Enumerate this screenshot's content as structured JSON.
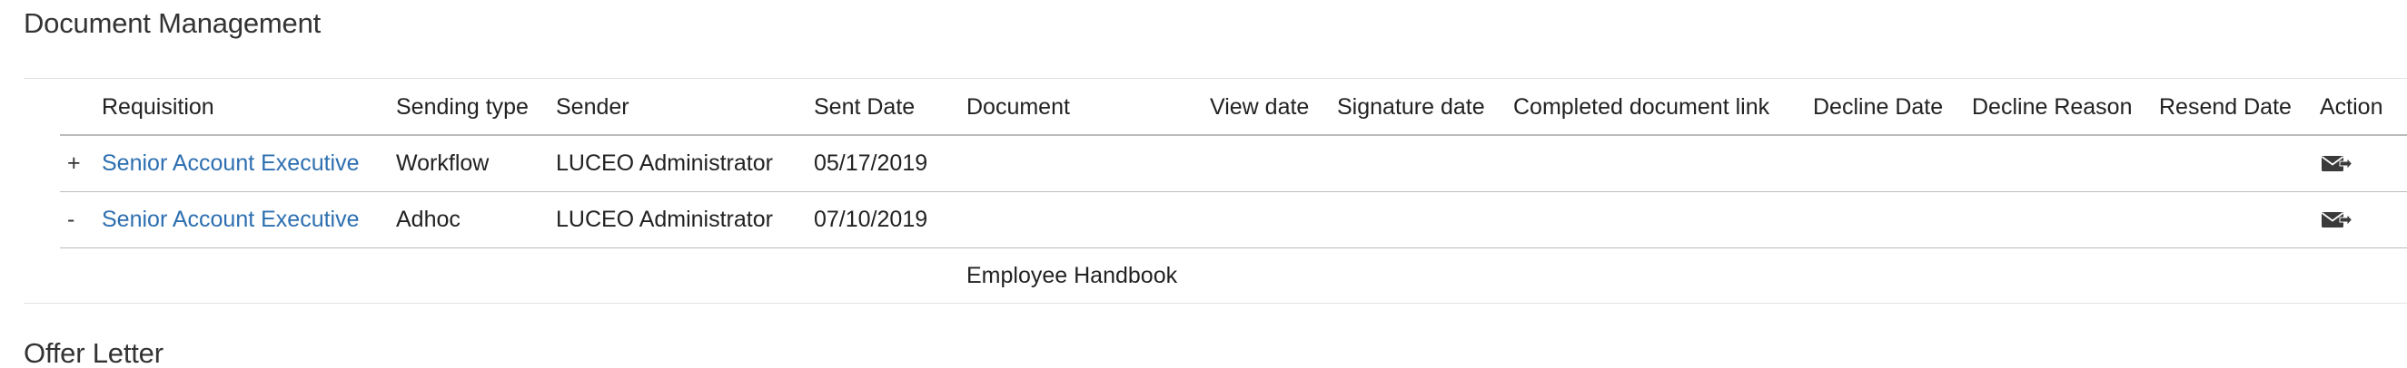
{
  "document_management": {
    "title": "Document Management",
    "columns": {
      "requisition": "Requisition",
      "sending_type": "Sending type",
      "sender": "Sender",
      "sent_date": "Sent Date",
      "document": "Document",
      "view_date": "View date",
      "signature_date": "Signature date",
      "completed_document_link": "Completed document link",
      "decline_date": "Decline Date",
      "decline_reason": "Decline Reason",
      "resend_date": "Resend Date",
      "action": "Action"
    },
    "rows": [
      {
        "toggle": "+",
        "requisition": "Senior Account Executive",
        "sending_type": "Workflow",
        "sender": "LUCEO Administrator",
        "sent_date": "05/17/2019",
        "action_icon": "send-envelope-icon"
      },
      {
        "toggle": "-",
        "requisition": "Senior Account Executive",
        "sending_type": "Adhoc",
        "sender": "LUCEO Administrator",
        "sent_date": "07/10/2019",
        "action_icon": "send-envelope-icon"
      }
    ],
    "expanded_detail": {
      "document": "Employee Handbook"
    }
  },
  "offer_letter": {
    "title": "Offer Letter"
  },
  "colors": {
    "link": "#2d6fb0",
    "text": "#222222",
    "rule": "#bcbcbc"
  }
}
